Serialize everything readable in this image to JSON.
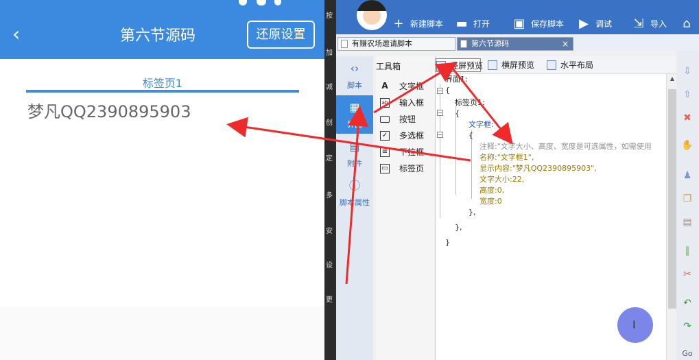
{
  "phone": {
    "title": "第六节源码",
    "back_icon": "‹",
    "restore_button": "还原设置",
    "tab_label": "标签页1",
    "content_text": "梦凡QQ2390895903",
    "colors": {
      "appbar": "#3b8ae0",
      "text": "#666666"
    }
  },
  "editor": {
    "leftbar_labels": [
      "按",
      "加",
      "减",
      "创",
      "定",
      "多",
      "安",
      "设",
      "更"
    ],
    "toolbar": {
      "new_script": "新建脚本",
      "open": "打开",
      "save_script": "保存脚本",
      "debug": "调试",
      "import": "导入"
    },
    "tabs": [
      {
        "label": "有赚农场邀请脚本"
      },
      {
        "label": "第六节源码",
        "close": "×"
      }
    ],
    "nav": [
      {
        "label": "脚本"
      },
      {
        "label": "界面"
      },
      {
        "label": "附件"
      },
      {
        "label": "脚本属性"
      }
    ],
    "toolbox": {
      "header": "工具箱",
      "items": [
        {
          "label": "文字框",
          "icon": "A"
        },
        {
          "label": "输入框",
          "icon": "ab"
        },
        {
          "label": "按钮",
          "icon": ""
        },
        {
          "label": "多选框",
          "icon": "✓"
        },
        {
          "label": "下拉框",
          "icon": "≡"
        },
        {
          "label": "标签页",
          "icon": "▭"
        }
      ]
    },
    "code_toolbar": {
      "portrait_preview": "竖屏预览",
      "landscape_preview": "横屏预览",
      "horizontal_layout": "水平布局"
    },
    "code_lines": [
      "界面1:",
      "{",
      "标签页1:",
      "{",
      "文字框:",
      "{",
      "注释:\"文字大小、高度、宽度是可选属性，如需使用",
      "名称:\"文字框1\",",
      "显示内容:\"梦凡QQ2390895903\",",
      "文字大小:22,",
      "高度:0,",
      "宽度:0",
      "},",
      "},",
      "}"
    ],
    "cursor_glyph": "I"
  }
}
